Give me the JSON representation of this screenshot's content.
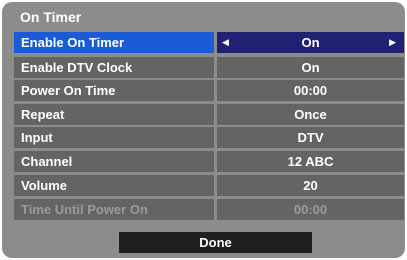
{
  "dialog": {
    "title": "On Timer",
    "rows": [
      {
        "label": "Enable On Timer",
        "value": "On",
        "selected": true
      },
      {
        "label": "Enable DTV Clock",
        "value": "On"
      },
      {
        "label": "Power On Time",
        "value": "00:00"
      },
      {
        "label": "Repeat",
        "value": "Once"
      },
      {
        "label": "Input",
        "value": "DTV"
      },
      {
        "label": "Channel",
        "value": "12 ABC"
      },
      {
        "label": "Volume",
        "value": "20"
      },
      {
        "label": "Time Until Power On",
        "value": "00:00",
        "disabled": true
      }
    ],
    "done_label": "Done"
  },
  "icons": {
    "left_arrow": "left-triangle",
    "right_arrow": "right-triangle"
  },
  "colors": {
    "panel_bg": "#8c8c8c",
    "row_bg": "#646464",
    "selected_label_bg": "#1a5bd6",
    "selected_value_bg": "#212173",
    "disabled_text": "#9a9a9a",
    "done_bg": "#1f1f1f"
  }
}
